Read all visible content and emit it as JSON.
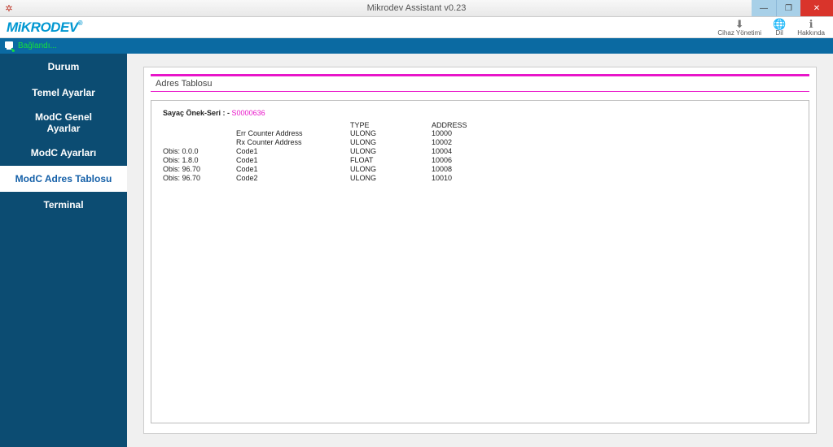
{
  "window": {
    "title": "Mikrodev Assistant v0.23"
  },
  "logo_text": "MiKRODEV",
  "logo_reg": "®",
  "header_actions": {
    "device": "Cihaz Yönetimi",
    "lang": "Dil",
    "about": "Hakkında"
  },
  "status": {
    "text": "Bağlandı..."
  },
  "sidebar": {
    "items": [
      {
        "label": "Durum"
      },
      {
        "label": "Temel Ayarlar"
      },
      {
        "label_line1": "ModC Genel",
        "label_line2": "Ayarlar"
      },
      {
        "label": "ModC Ayarları"
      },
      {
        "label": "ModC Adres Tablosu"
      },
      {
        "label": "Terminal"
      }
    ]
  },
  "panel": {
    "title": "Adres Tablosu",
    "serial_label": "Sayaç Önek-Seri : - ",
    "serial_value": "S0000636",
    "headers": {
      "type": "TYPE",
      "address": "ADDRESS"
    },
    "rows": [
      {
        "obis": "",
        "desc": "Err Counter Address",
        "type": "ULONG",
        "addr": "10000"
      },
      {
        "obis": "",
        "desc": "Rx Counter Address",
        "type": "ULONG",
        "addr": "10002"
      },
      {
        "obis": "Obis: 0.0.0",
        "desc": "Code1",
        "type": "ULONG",
        "addr": "10004"
      },
      {
        "obis": "Obis: 1.8.0",
        "desc": "Code1",
        "type": "FLOAT",
        "addr": "10006"
      },
      {
        "obis": "Obis: 96.70",
        "desc": "Code1",
        "type": "ULONG",
        "addr": "10008"
      },
      {
        "obis": "Obis: 96.70",
        "desc": "Code2",
        "type": "ULONG",
        "addr": "10010"
      }
    ]
  }
}
